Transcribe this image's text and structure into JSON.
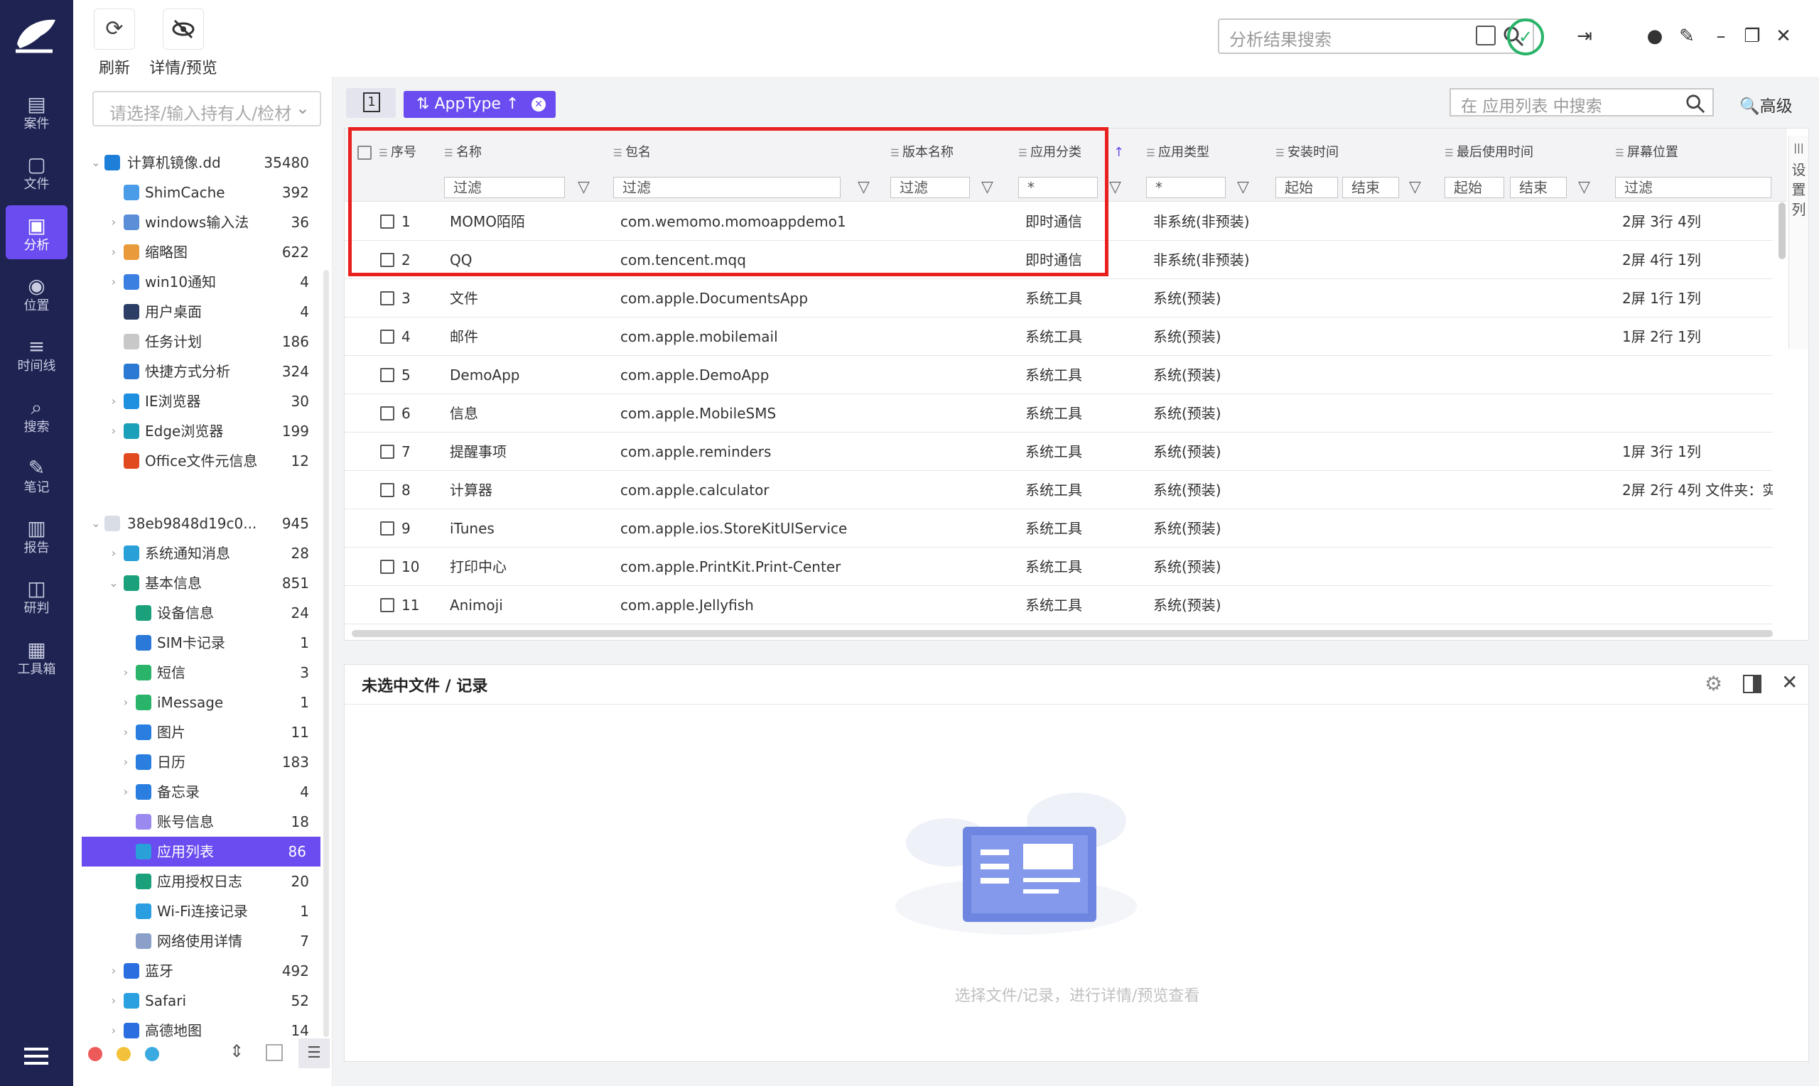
{
  "nav": {
    "items": [
      {
        "label": "案件",
        "icon": "case-icon"
      },
      {
        "label": "文件",
        "icon": "file-icon"
      },
      {
        "label": "分析",
        "icon": "analysis-icon",
        "active": true
      },
      {
        "label": "位置",
        "icon": "location-icon"
      },
      {
        "label": "时间线",
        "icon": "timeline-icon"
      },
      {
        "label": "搜索",
        "icon": "search-icon"
      },
      {
        "label": "笔记",
        "icon": "notes-icon"
      },
      {
        "label": "报告",
        "icon": "report-icon"
      },
      {
        "label": "研判",
        "icon": "judge-icon"
      },
      {
        "label": "工具箱",
        "icon": "toolbox-icon"
      }
    ]
  },
  "toolbar": {
    "refresh_label": "刷新",
    "detail_label": "详情/预览",
    "search_placeholder": "分析结果搜索"
  },
  "sidebar": {
    "holder_placeholder": "请选择/输入持有人/检材",
    "tree": [
      {
        "label": "计算机镜像.dd",
        "count": "35480",
        "level": 0,
        "expanded": true,
        "icon_color": "#1e7fd8"
      },
      {
        "label": "ShimCache",
        "count": "392",
        "level": 1,
        "icon_color": "#4a9be8"
      },
      {
        "label": "windows输入法",
        "count": "36",
        "level": 1,
        "arrow": true,
        "icon_color": "#5a8fd8"
      },
      {
        "label": "缩略图",
        "count": "622",
        "level": 1,
        "arrow": true,
        "icon_color": "#e99a3b"
      },
      {
        "label": "win10通知",
        "count": "4",
        "level": 1,
        "arrow": true,
        "icon_color": "#3b7fe0"
      },
      {
        "label": "用户桌面",
        "count": "4",
        "level": 1,
        "icon_color": "#2c3e66"
      },
      {
        "label": "任务计划",
        "count": "186",
        "level": 1,
        "icon_color": "#c8c8c8"
      },
      {
        "label": "快捷方式分析",
        "count": "324",
        "level": 1,
        "icon_color": "#2c79d4"
      },
      {
        "label": "IE浏览器",
        "count": "30",
        "level": 1,
        "arrow": true,
        "icon_color": "#1f8fe0"
      },
      {
        "label": "Edge浏览器",
        "count": "199",
        "level": 1,
        "arrow": true,
        "icon_color": "#1aa0b8"
      },
      {
        "label": "Office文件元信息",
        "count": "12",
        "level": 1,
        "icon_color": "#e04a1e"
      },
      {
        "label": "38eb9848d19c0...",
        "count": "945",
        "level": 0,
        "expanded": true,
        "icon_color": "#d8dde6"
      },
      {
        "label": "系统通知消息",
        "count": "28",
        "level": 1,
        "arrow": true,
        "icon_color": "#2aa0d8"
      },
      {
        "label": "基本信息",
        "count": "851",
        "level": 1,
        "expanded": true,
        "icon_color": "#1aa07a"
      },
      {
        "label": "设备信息",
        "count": "24",
        "level": 2,
        "icon_color": "#1aa07a"
      },
      {
        "label": "SIM卡记录",
        "count": "1",
        "level": 2,
        "icon_color": "#2a78d8"
      },
      {
        "label": "短信",
        "count": "3",
        "level": 2,
        "arrow": true,
        "icon_color": "#2ab46a"
      },
      {
        "label": "iMessage",
        "count": "1",
        "level": 2,
        "arrow": true,
        "icon_color": "#2ab46a"
      },
      {
        "label": "图片",
        "count": "11",
        "level": 2,
        "arrow": true,
        "icon_color": "#2a7ee0"
      },
      {
        "label": "日历",
        "count": "183",
        "level": 2,
        "arrow": true,
        "icon_color": "#2a7ee0"
      },
      {
        "label": "备忘录",
        "count": "4",
        "level": 2,
        "arrow": true,
        "icon_color": "#2a7ee0"
      },
      {
        "label": "账号信息",
        "count": "18",
        "level": 2,
        "icon_color": "#9a8af0"
      },
      {
        "label": "应用列表",
        "count": "86",
        "level": 2,
        "selected": true,
        "icon_color": "#2aa0d8"
      },
      {
        "label": "应用授权日志",
        "count": "20",
        "level": 2,
        "icon_color": "#1aa07a"
      },
      {
        "label": "Wi-Fi连接记录",
        "count": "1",
        "level": 2,
        "icon_color": "#2a9ee0"
      },
      {
        "label": "网络使用详情",
        "count": "7",
        "level": 2,
        "icon_color": "#8aa0c8"
      },
      {
        "label": "蓝牙",
        "count": "492",
        "level": 1,
        "arrow": true,
        "icon_color": "#2a6ee0"
      },
      {
        "label": "Safari",
        "count": "52",
        "level": 1,
        "arrow": true,
        "icon_color": "#2aa0e0"
      },
      {
        "label": "高德地图",
        "count": "14",
        "level": 1,
        "arrow": true,
        "icon_color": "#2a6ee0"
      }
    ],
    "dots": [
      "#ee5a5a",
      "#f3c23a",
      "#3aaae0"
    ]
  },
  "grid": {
    "group_count": "1",
    "sort_tag": "AppType",
    "search_placeholder": "在 应用列表 中搜索",
    "advanced_label": "高级",
    "settings_label": "设置列",
    "headers": {
      "seq": "序号",
      "name": "名称",
      "pkg": "包名",
      "ver": "版本名称",
      "cat": "应用分类",
      "type": "应用类型",
      "install": "安装时间",
      "lastuse": "最后使用时间",
      "screen": "屏幕位置"
    },
    "filters": {
      "name": "过滤",
      "pkg": "过滤",
      "ver": "过滤",
      "cat": "*",
      "type": "*",
      "start1": "起始",
      "end1": "结束",
      "start2": "起始",
      "end2": "结束",
      "screen": "过滤"
    },
    "rows": [
      {
        "seq": "1",
        "name": "MOMO陌陌",
        "pkg": "com.wemomo.momoappdemo1",
        "cat": "即时通信",
        "type": "非系统(非预装)",
        "screen": "2屏 3行 4列"
      },
      {
        "seq": "2",
        "name": "QQ",
        "pkg": "com.tencent.mqq",
        "cat": "即时通信",
        "type": "非系统(非预装)",
        "screen": "2屏 4行 1列"
      },
      {
        "seq": "3",
        "name": "文件",
        "pkg": "com.apple.DocumentsApp",
        "cat": "系统工具",
        "type": "系统(预装)",
        "screen": "2屏 1行 1列"
      },
      {
        "seq": "4",
        "name": "邮件",
        "pkg": "com.apple.mobilemail",
        "cat": "系统工具",
        "type": "系统(预装)",
        "screen": "1屏 2行 1列"
      },
      {
        "seq": "5",
        "name": "DemoApp",
        "pkg": "com.apple.DemoApp",
        "cat": "系统工具",
        "type": "系统(预装)",
        "screen": ""
      },
      {
        "seq": "6",
        "name": "信息",
        "pkg": "com.apple.MobileSMS",
        "cat": "系统工具",
        "type": "系统(预装)",
        "screen": ""
      },
      {
        "seq": "7",
        "name": "提醒事项",
        "pkg": "com.apple.reminders",
        "cat": "系统工具",
        "type": "系统(预装)",
        "screen": "1屏 3行 1列"
      },
      {
        "seq": "8",
        "name": "计算器",
        "pkg": "com.apple.calculator",
        "cat": "系统工具",
        "type": "系统(预装)",
        "screen": "2屏 2行 4列 文件夹：实"
      },
      {
        "seq": "9",
        "name": "iTunes",
        "pkg": "com.apple.ios.StoreKitUIService",
        "cat": "系统工具",
        "type": "系统(预装)",
        "screen": ""
      },
      {
        "seq": "10",
        "name": "打印中心",
        "pkg": "com.apple.PrintKit.Print-Center",
        "cat": "系统工具",
        "type": "系统(预装)",
        "screen": ""
      },
      {
        "seq": "11",
        "name": "Animoji",
        "pkg": "com.apple.Jellyfish",
        "cat": "系统工具",
        "type": "系统(预装)",
        "screen": ""
      }
    ],
    "highlight_color": "#e8201e"
  },
  "preview": {
    "title": "未选中文件 / 记录",
    "empty_text": "选择文件/记录，进行详情/预览查看"
  }
}
